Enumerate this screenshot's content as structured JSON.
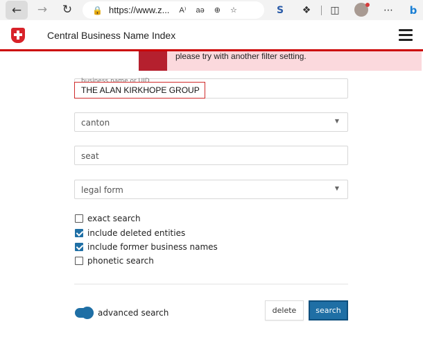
{
  "browser": {
    "url": "https://www.z...",
    "read_aloud": "A⁾",
    "translate": "aə",
    "icons": [
      "back-icon",
      "forward-icon",
      "reload-icon",
      "lock-icon",
      "read-aloud-icon",
      "translate-icon",
      "zoom-icon",
      "favorite-icon",
      "extension-s-icon",
      "extensions-icon",
      "split-screen-icon",
      "profile-avatar",
      "more-icon",
      "edge-copilot-icon"
    ]
  },
  "header": {
    "title": "Central Business Name Index"
  },
  "alert": {
    "message": "please try with another filter setting."
  },
  "form": {
    "name_label": "business name or UID",
    "name_value": "THE ALAN KIRKHOPE GROUP",
    "canton_placeholder": "canton",
    "seat_placeholder": "seat",
    "legal_form_placeholder": "legal form",
    "options": [
      {
        "label": "exact search",
        "checked": false
      },
      {
        "label": "include deleted entities",
        "checked": true
      },
      {
        "label": "include former business names",
        "checked": true
      },
      {
        "label": "phonetic search",
        "checked": false
      }
    ],
    "advanced_search_label": "advanced search",
    "advanced_search_on": true,
    "delete_label": "delete",
    "search_label": "search"
  },
  "colors": {
    "accent": "#1f6fa5",
    "swiss_red": "#d8232a",
    "alert_bg": "#fbd9dd",
    "alert_side": "#b5202e"
  }
}
